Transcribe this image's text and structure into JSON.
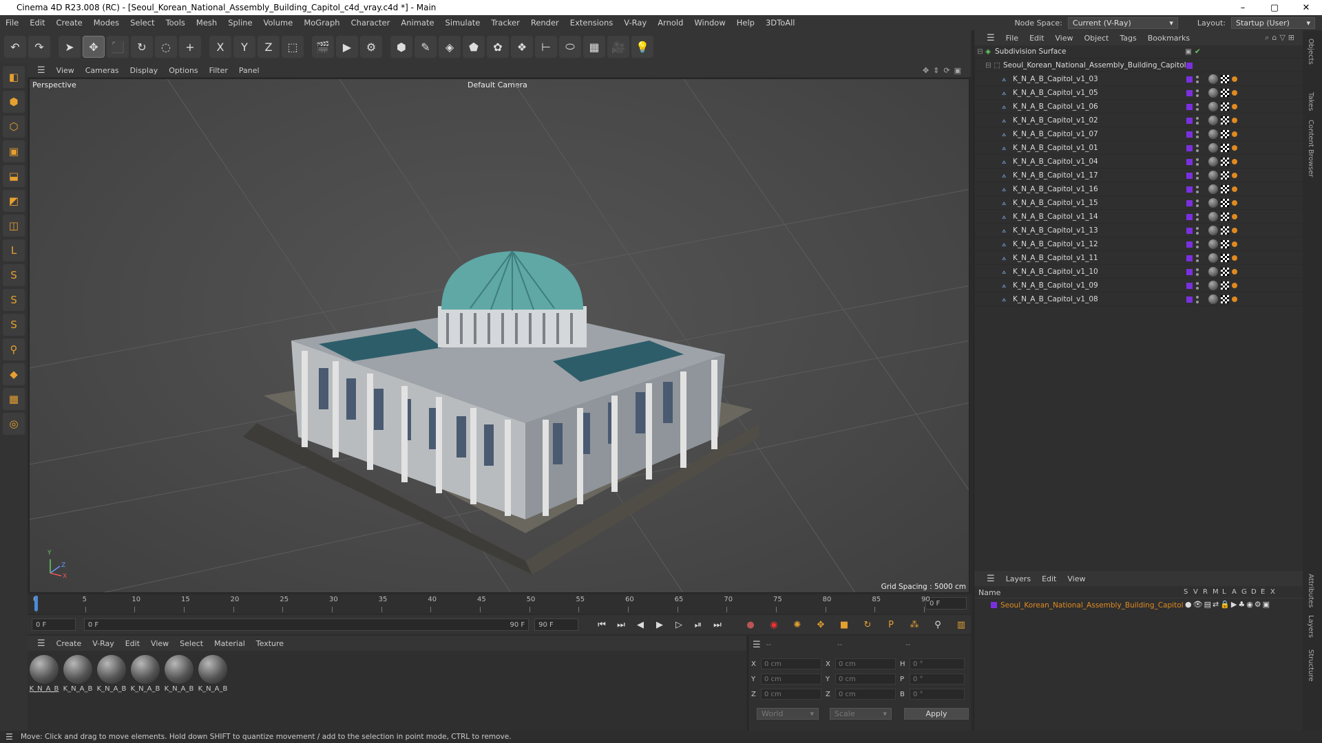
{
  "window": {
    "title": "Cinema 4D R23.008 (RC) - [Seoul_Korean_National_Assembly_Building_Capitol_c4d_vray.c4d *] - Main",
    "controls": [
      "–",
      "▢",
      "✕"
    ]
  },
  "menubar": {
    "items": [
      "File",
      "Edit",
      "Create",
      "Modes",
      "Select",
      "Tools",
      "Mesh",
      "Spline",
      "Volume",
      "MoGraph",
      "Character",
      "Animate",
      "Simulate",
      "Tracker",
      "Render",
      "Extensions",
      "V-Ray",
      "Arnold",
      "Window",
      "Help",
      "3DToAll"
    ],
    "node_space_label": "Node Space:",
    "node_space_value": "Current (V-Ray)",
    "layout_label": "Layout:",
    "layout_value": "Startup (User)"
  },
  "toolbar": {
    "icons": [
      "undo-icon",
      "redo-icon",
      "select-arrow-icon",
      "move-icon",
      "scale-icon",
      "rotate-icon",
      "live-select-icon",
      "transform-icon",
      "x-axis-icon",
      "y-axis-icon",
      "z-axis-icon",
      "coordinate-system-icon",
      "render-region-icon",
      "render-view-icon",
      "render-settings-icon",
      "cube-primitive-icon",
      "spline-pen-icon",
      "subdivision-icon",
      "extrude-icon",
      "cloner-icon",
      "mograph-icon",
      "deformer-icon",
      "field-icon",
      "floor-icon",
      "camera-icon",
      "light-icon"
    ],
    "glyphs": [
      "↶",
      "↷",
      "➤",
      "✥",
      "⬛",
      "↻",
      "◌",
      "+",
      "X",
      "Y",
      "Z",
      "⬚",
      "🎬",
      "▶",
      "⚙",
      "⬢",
      "✎",
      "◈",
      "⬟",
      "✿",
      "❖",
      "⊢",
      "⬭",
      "▦",
      "🎥",
      "💡"
    ]
  },
  "left_tools": {
    "glyphs": [
      "◧",
      "⬢",
      "⬡",
      "▣",
      "⬓",
      "◩",
      "◫",
      "L",
      "S",
      "S",
      "S",
      "⚲",
      "◆",
      "▦",
      "◎"
    ]
  },
  "viewport": {
    "menu": [
      "View",
      "Cameras",
      "Display",
      "Options",
      "Filter",
      "Panel"
    ],
    "label": "Perspective",
    "camera": "Default Camera",
    "grid_spacing": "Grid Spacing : 5000 cm",
    "axis_labels": {
      "y": "Y",
      "z": "Z",
      "x": "X"
    }
  },
  "timeline": {
    "ticks": [
      "0",
      "5",
      "10",
      "15",
      "20",
      "25",
      "30",
      "35",
      "40",
      "45",
      "50",
      "55",
      "60",
      "65",
      "70",
      "75",
      "80",
      "85",
      "90"
    ],
    "current_frame": "0 F"
  },
  "transport": {
    "start": "0 F",
    "range_start": "0 F",
    "range_end": "90 F",
    "end": "90 F",
    "buttons": [
      "⏮",
      "⏭",
      "◀",
      "▶",
      "▷",
      "⏯",
      "⏭"
    ]
  },
  "materials": {
    "menu": [
      "Create",
      "V-Ray",
      "Edit",
      "View",
      "Select",
      "Material",
      "Texture"
    ],
    "items": [
      "K_N_A_B",
      "K_N_A_B",
      "K_N_A_B",
      "K_N_A_B",
      "K_N_A_B",
      "K_N_A_B"
    ]
  },
  "attributes": {
    "headers": [
      "--",
      "--",
      "--"
    ],
    "rows": [
      {
        "a": "X",
        "av": "0 cm",
        "b": "X",
        "bv": "0 cm",
        "c": "H",
        "cv": "0 °"
      },
      {
        "a": "Y",
        "av": "0 cm",
        "b": "Y",
        "bv": "0 cm",
        "c": "P",
        "cv": "0 °"
      },
      {
        "a": "Z",
        "av": "0 cm",
        "b": "Z",
        "bv": "0 cm",
        "c": "B",
        "cv": "0 °"
      }
    ],
    "world": "World",
    "scale": "Scale",
    "apply": "Apply"
  },
  "objects": {
    "menu": [
      "File",
      "Edit",
      "View",
      "Object",
      "Tags",
      "Bookmarks"
    ],
    "root": "Subdivision Surface",
    "group": "Seoul_Korean_National_Assembly_Building_Capitol",
    "children": [
      "K_N_A_B_Capitol_v1_03",
      "K_N_A_B_Capitol_v1_05",
      "K_N_A_B_Capitol_v1_06",
      "K_N_A_B_Capitol_v1_02",
      "K_N_A_B_Capitol_v1_07",
      "K_N_A_B_Capitol_v1_01",
      "K_N_A_B_Capitol_v1_04",
      "K_N_A_B_Capitol_v1_17",
      "K_N_A_B_Capitol_v1_16",
      "K_N_A_B_Capitol_v1_15",
      "K_N_A_B_Capitol_v1_14",
      "K_N_A_B_Capitol_v1_13",
      "K_N_A_B_Capitol_v1_12",
      "K_N_A_B_Capitol_v1_11",
      "K_N_A_B_Capitol_v1_10",
      "K_N_A_B_Capitol_v1_09",
      "K_N_A_B_Capitol_v1_08"
    ]
  },
  "layers": {
    "menu": [
      "Layers",
      "Edit",
      "View"
    ],
    "name_header": "Name",
    "cols": [
      "S",
      "V",
      "R",
      "M",
      "L",
      "A",
      "G",
      "D",
      "E",
      "X"
    ],
    "layer": "Seoul_Korean_National_Assembly_Building_Capitol"
  },
  "right_tabs": [
    "Objects",
    "Takes",
    "Content Browser",
    "Attributes",
    "Layers",
    "Structure"
  ],
  "status": "Move: Click and drag to move elements. Hold down SHIFT to quantize movement / add to the selection in point mode, CTRL to remove.",
  "colors": {
    "accent": "#7b30e0",
    "layer_text": "#e08a20",
    "dome": "#5fa8a6"
  }
}
